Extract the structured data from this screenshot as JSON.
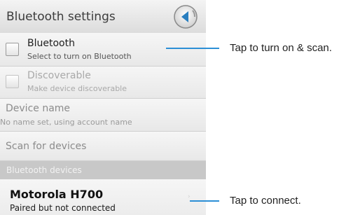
{
  "header": {
    "title": "Bluetooth settings",
    "back_icon": "back-arrow-icon"
  },
  "settings": [
    {
      "title": "Bluetooth",
      "subtitle": "Select to turn on Bluetooth",
      "checked": false,
      "enabled": true
    },
    {
      "title": "Discoverable",
      "subtitle": "Make device discoverable",
      "checked": false,
      "enabled": false
    },
    {
      "title": "Device name",
      "subtitle": "No name set, using account name"
    },
    {
      "title": "Scan for devices"
    }
  ],
  "devices": {
    "header": "Bluetooth devices",
    "items": [
      {
        "name": "Motorola H700",
        "status": "Paired but not connected"
      }
    ]
  },
  "callouts": [
    {
      "text": "Tap to turn on & scan."
    },
    {
      "text": "Tap to connect."
    }
  ],
  "colors": {
    "callout_line": "#2c8fd6",
    "section_header": "#c8c8c8"
  }
}
